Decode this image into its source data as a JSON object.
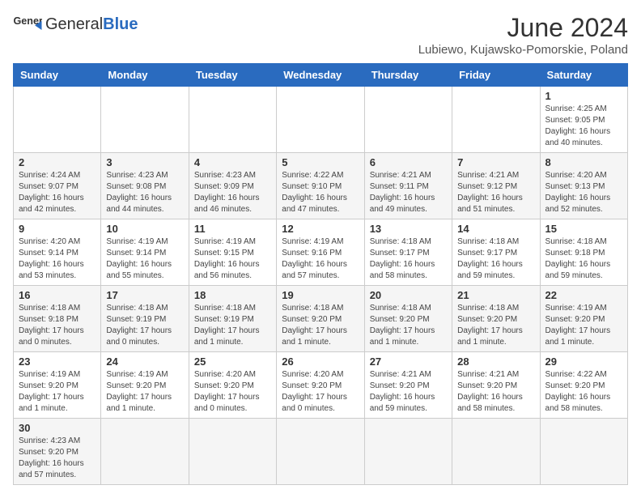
{
  "logo": {
    "text_general": "General",
    "text_blue": "Blue"
  },
  "title": {
    "month_year": "June 2024",
    "location": "Lubiewo, Kujawsko-Pomorskie, Poland"
  },
  "headers": [
    "Sunday",
    "Monday",
    "Tuesday",
    "Wednesday",
    "Thursday",
    "Friday",
    "Saturday"
  ],
  "weeks": [
    {
      "shade": "white",
      "days": [
        {
          "num": "",
          "info": ""
        },
        {
          "num": "",
          "info": ""
        },
        {
          "num": "",
          "info": ""
        },
        {
          "num": "",
          "info": ""
        },
        {
          "num": "",
          "info": ""
        },
        {
          "num": "",
          "info": ""
        },
        {
          "num": "1",
          "info": "Sunrise: 4:25 AM\nSunset: 9:05 PM\nDaylight: 16 hours\nand 40 minutes."
        }
      ]
    },
    {
      "shade": "shaded",
      "days": [
        {
          "num": "2",
          "info": "Sunrise: 4:24 AM\nSunset: 9:07 PM\nDaylight: 16 hours\nand 42 minutes."
        },
        {
          "num": "3",
          "info": "Sunrise: 4:23 AM\nSunset: 9:08 PM\nDaylight: 16 hours\nand 44 minutes."
        },
        {
          "num": "4",
          "info": "Sunrise: 4:23 AM\nSunset: 9:09 PM\nDaylight: 16 hours\nand 46 minutes."
        },
        {
          "num": "5",
          "info": "Sunrise: 4:22 AM\nSunset: 9:10 PM\nDaylight: 16 hours\nand 47 minutes."
        },
        {
          "num": "6",
          "info": "Sunrise: 4:21 AM\nSunset: 9:11 PM\nDaylight: 16 hours\nand 49 minutes."
        },
        {
          "num": "7",
          "info": "Sunrise: 4:21 AM\nSunset: 9:12 PM\nDaylight: 16 hours\nand 51 minutes."
        },
        {
          "num": "8",
          "info": "Sunrise: 4:20 AM\nSunset: 9:13 PM\nDaylight: 16 hours\nand 52 minutes."
        }
      ]
    },
    {
      "shade": "white",
      "days": [
        {
          "num": "9",
          "info": "Sunrise: 4:20 AM\nSunset: 9:14 PM\nDaylight: 16 hours\nand 53 minutes."
        },
        {
          "num": "10",
          "info": "Sunrise: 4:19 AM\nSunset: 9:14 PM\nDaylight: 16 hours\nand 55 minutes."
        },
        {
          "num": "11",
          "info": "Sunrise: 4:19 AM\nSunset: 9:15 PM\nDaylight: 16 hours\nand 56 minutes."
        },
        {
          "num": "12",
          "info": "Sunrise: 4:19 AM\nSunset: 9:16 PM\nDaylight: 16 hours\nand 57 minutes."
        },
        {
          "num": "13",
          "info": "Sunrise: 4:18 AM\nSunset: 9:17 PM\nDaylight: 16 hours\nand 58 minutes."
        },
        {
          "num": "14",
          "info": "Sunrise: 4:18 AM\nSunset: 9:17 PM\nDaylight: 16 hours\nand 59 minutes."
        },
        {
          "num": "15",
          "info": "Sunrise: 4:18 AM\nSunset: 9:18 PM\nDaylight: 16 hours\nand 59 minutes."
        }
      ]
    },
    {
      "shade": "shaded",
      "days": [
        {
          "num": "16",
          "info": "Sunrise: 4:18 AM\nSunset: 9:18 PM\nDaylight: 17 hours\nand 0 minutes."
        },
        {
          "num": "17",
          "info": "Sunrise: 4:18 AM\nSunset: 9:19 PM\nDaylight: 17 hours\nand 0 minutes."
        },
        {
          "num": "18",
          "info": "Sunrise: 4:18 AM\nSunset: 9:19 PM\nDaylight: 17 hours\nand 1 minute."
        },
        {
          "num": "19",
          "info": "Sunrise: 4:18 AM\nSunset: 9:20 PM\nDaylight: 17 hours\nand 1 minute."
        },
        {
          "num": "20",
          "info": "Sunrise: 4:18 AM\nSunset: 9:20 PM\nDaylight: 17 hours\nand 1 minute."
        },
        {
          "num": "21",
          "info": "Sunrise: 4:18 AM\nSunset: 9:20 PM\nDaylight: 17 hours\nand 1 minute."
        },
        {
          "num": "22",
          "info": "Sunrise: 4:19 AM\nSunset: 9:20 PM\nDaylight: 17 hours\nand 1 minute."
        }
      ]
    },
    {
      "shade": "white",
      "days": [
        {
          "num": "23",
          "info": "Sunrise: 4:19 AM\nSunset: 9:20 PM\nDaylight: 17 hours\nand 1 minute."
        },
        {
          "num": "24",
          "info": "Sunrise: 4:19 AM\nSunset: 9:20 PM\nDaylight: 17 hours\nand 1 minute."
        },
        {
          "num": "25",
          "info": "Sunrise: 4:20 AM\nSunset: 9:20 PM\nDaylight: 17 hours\nand 0 minutes."
        },
        {
          "num": "26",
          "info": "Sunrise: 4:20 AM\nSunset: 9:20 PM\nDaylight: 17 hours\nand 0 minutes."
        },
        {
          "num": "27",
          "info": "Sunrise: 4:21 AM\nSunset: 9:20 PM\nDaylight: 16 hours\nand 59 minutes."
        },
        {
          "num": "28",
          "info": "Sunrise: 4:21 AM\nSunset: 9:20 PM\nDaylight: 16 hours\nand 58 minutes."
        },
        {
          "num": "29",
          "info": "Sunrise: 4:22 AM\nSunset: 9:20 PM\nDaylight: 16 hours\nand 58 minutes."
        }
      ]
    },
    {
      "shade": "shaded",
      "days": [
        {
          "num": "30",
          "info": "Sunrise: 4:23 AM\nSunset: 9:20 PM\nDaylight: 16 hours\nand 57 minutes."
        },
        {
          "num": "",
          "info": ""
        },
        {
          "num": "",
          "info": ""
        },
        {
          "num": "",
          "info": ""
        },
        {
          "num": "",
          "info": ""
        },
        {
          "num": "",
          "info": ""
        },
        {
          "num": "",
          "info": ""
        }
      ]
    }
  ]
}
